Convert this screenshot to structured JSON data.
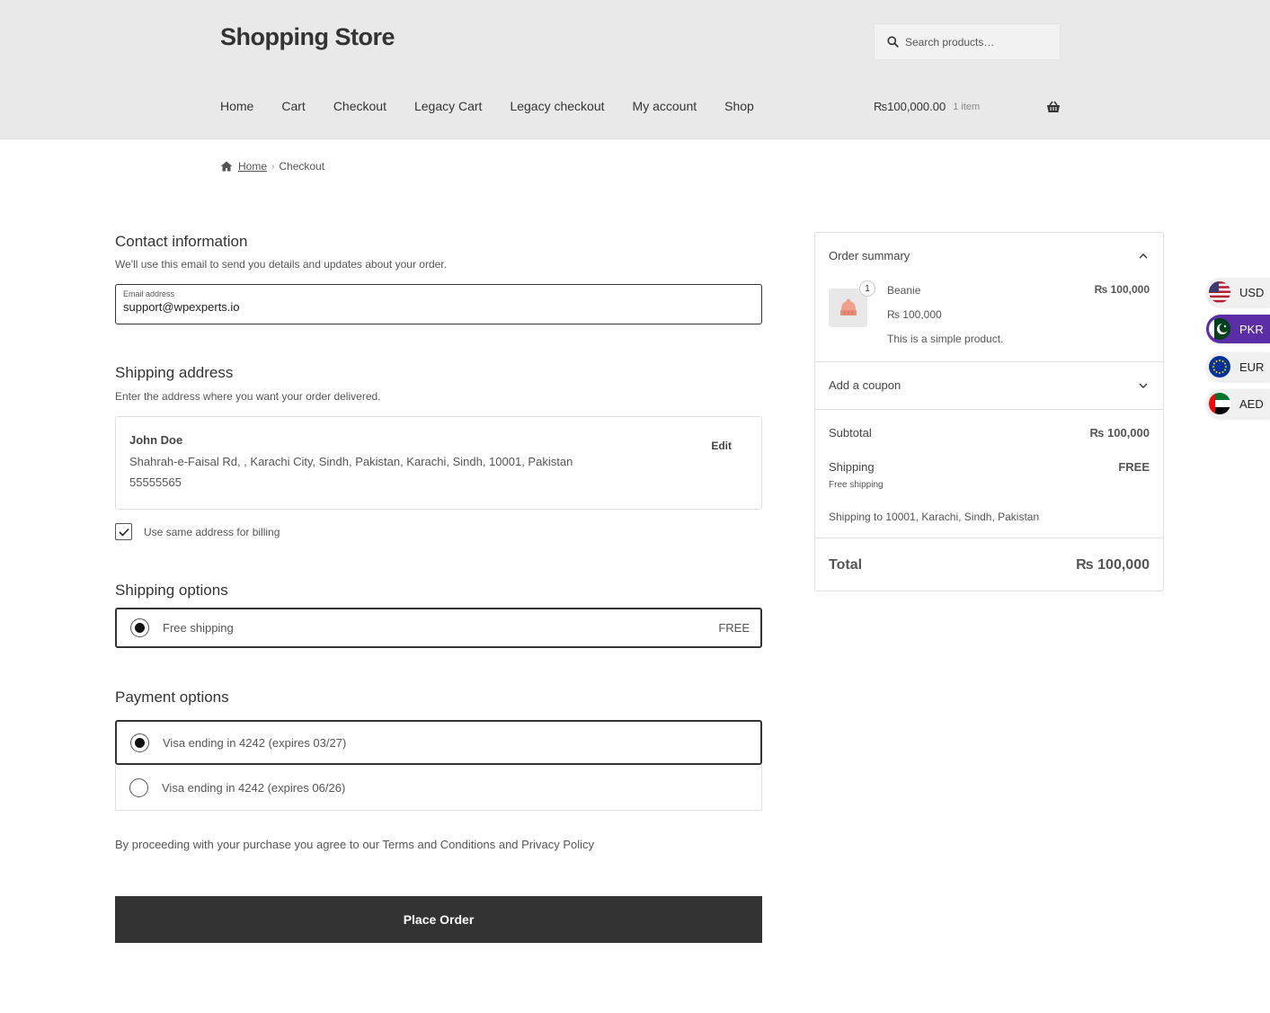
{
  "header": {
    "site_title": "Shopping Store",
    "search_placeholder": "Search products…",
    "nav": [
      "Home",
      "Cart",
      "Checkout",
      "Legacy Cart",
      "Legacy checkout",
      "My account",
      "Shop"
    ],
    "cart_amount": "₨100,000.00",
    "cart_count": "1 item"
  },
  "breadcrumb": {
    "home": "Home",
    "current": "Checkout"
  },
  "contact": {
    "title": "Contact information",
    "description": "We'll use this email to send you details and updates about your order.",
    "email_label": "Email address",
    "email_value": "support@wpexperts.io"
  },
  "shipping_address": {
    "title": "Shipping address",
    "description": "Enter the address where you want your order delivered.",
    "name": "John Doe",
    "address": "Shahrah-e-Faisal Rd, , Karachi City, Sindh, Pakistan, Karachi, Sindh, 10001, Pakistan",
    "phone": "55555565",
    "edit_label": "Edit",
    "billing_same_label": "Use same address for billing",
    "billing_same_checked": true
  },
  "shipping_options": {
    "title": "Shipping options",
    "option_label": "Free shipping",
    "option_price": "FREE"
  },
  "payment_options": {
    "title": "Payment options",
    "methods": [
      {
        "label": "Visa ending in 4242 (expires 03/27)",
        "selected": true
      },
      {
        "label": "Visa ending in 4242 (expires 06/26)",
        "selected": false
      }
    ]
  },
  "terms_text": "By proceeding with your purchase you agree to our Terms and Conditions and Privacy Policy",
  "place_order_label": "Place Order",
  "summary": {
    "title": "Order summary",
    "item": {
      "name": "Beanie",
      "quantity": "1",
      "line_price": "₨ 100,000",
      "unit_price": "₨ 100,000",
      "description": "This is a simple product."
    },
    "coupon_label": "Add a coupon",
    "subtotal_label": "Subtotal",
    "subtotal_value": "₨ 100,000",
    "shipping_label": "Shipping",
    "shipping_value": "FREE",
    "shipping_method": "Free shipping",
    "shipping_to": "Shipping to 10001, Karachi, Sindh, Pakistan",
    "total_label": "Total",
    "total_value": "₨ 100,000"
  },
  "currencies": [
    {
      "code": "USD",
      "flag": "us-flag-icon",
      "active": false
    },
    {
      "code": "PKR",
      "flag": "pk-flag-icon",
      "active": true
    },
    {
      "code": "EUR",
      "flag": "eu-flag-icon",
      "active": false
    },
    {
      "code": "AED",
      "flag": "ae-flag-icon",
      "active": false
    }
  ],
  "colors": {
    "header_bg": "#e9e9e9",
    "button_bg": "#333333",
    "active_currency": "#5b2ea6"
  }
}
